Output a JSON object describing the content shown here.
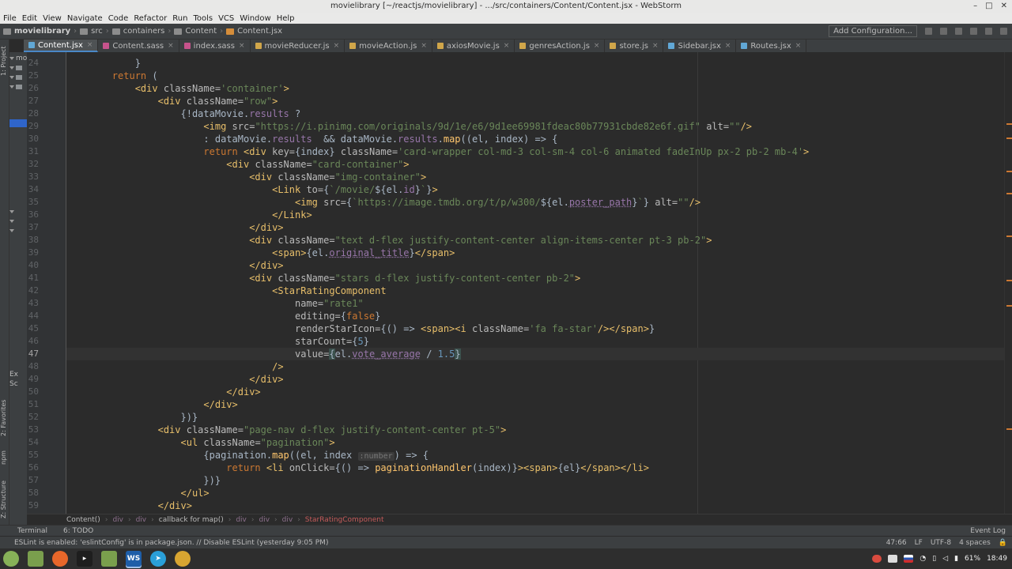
{
  "window": {
    "title": "movielibrary [~/reactjs/movielibrary] - .../src/containers/Content/Content.jsx - WebStorm",
    "controls": [
      "–",
      "□",
      "✕"
    ]
  },
  "menu": [
    "File",
    "Edit",
    "View",
    "Navigate",
    "Code",
    "Refactor",
    "Run",
    "Tools",
    "VCS",
    "Window",
    "Help"
  ],
  "breadcrumbs": [
    "movielibrary",
    "src",
    "containers",
    "Content",
    "Content.jsx"
  ],
  "toolbar": {
    "add_config": "Add Configuration..."
  },
  "tabs": [
    {
      "label": "Content.jsx",
      "kind": "jsx",
      "active": true
    },
    {
      "label": "Content.sass",
      "kind": "sass"
    },
    {
      "label": "index.sass",
      "kind": "sass"
    },
    {
      "label": "movieReducer.js",
      "kind": "js"
    },
    {
      "label": "movieAction.js",
      "kind": "js"
    },
    {
      "label": "axiosMovie.js",
      "kind": "js"
    },
    {
      "label": "genresAction.js",
      "kind": "js"
    },
    {
      "label": "store.js",
      "kind": "js"
    },
    {
      "label": "Sidebar.jsx",
      "kind": "jsx"
    },
    {
      "label": "Routes.jsx",
      "kind": "jsx"
    }
  ],
  "side_labels": {
    "project": "1: Project",
    "favorites": "2: Favorites",
    "npm": "npm",
    "structure": "Z: Structure"
  },
  "project_tree_fragments": [
    "mo",
    "Ex",
    "Sc"
  ],
  "editor": {
    "current_line": 47,
    "lines": [
      {
        "n": 24,
        "html": "            <span class=\"p\">}</span>"
      },
      {
        "n": 25,
        "html": "        <span class=\"k\">return</span> <span class=\"p\">(</span>"
      },
      {
        "n": 26,
        "html": "            <span class=\"t\">&lt;div</span> <span class=\"a\">className=</span><span class=\"s\">'container'</span><span class=\"t\">&gt;</span>"
      },
      {
        "n": 27,
        "html": "                <span class=\"t\">&lt;div</span> <span class=\"a\">className=</span><span class=\"s\">\"row\"</span><span class=\"t\">&gt;</span>"
      },
      {
        "n": 28,
        "html": "                    <span class=\"p\">{!dataMovie.</span><span class=\"v\">results</span> <span class=\"p\">?</span>"
      },
      {
        "n": 29,
        "html": "                        <span class=\"t\">&lt;img</span> <span class=\"a\">src=</span><span class=\"s\">\"https://i.pinimg.com/originals/9d/1e/e6/9d1ee69981fdeac80b77931cbde82e6f.gif\"</span> <span class=\"a\">alt=</span><span class=\"s\">\"\"</span><span class=\"t\">/&gt;</span>"
      },
      {
        "n": 30,
        "html": "                        <span class=\"p\">: dataMovie.</span><span class=\"v\">results</span>  <span class=\"p\">&amp;&amp; dataMovie.</span><span class=\"v\">results</span><span class=\"p\">.</span><span class=\"f\">map</span><span class=\"p\">((el, index) =&gt; {</span>"
      },
      {
        "n": 31,
        "html": "                        <span class=\"k\">return</span> <span class=\"t\">&lt;div</span> <span class=\"a\">key=</span><span class=\"p\">{index}</span> <span class=\"a\">className=</span><span class=\"s\">'card-wrapper col-md-3 col-sm-4 col-6 animated fadeInUp px-2 pb-2 mb-4'</span><span class=\"t\">&gt;</span>"
      },
      {
        "n": 32,
        "html": "                            <span class=\"t\">&lt;div</span> <span class=\"a\">className=</span><span class=\"s\">\"card-container\"</span><span class=\"t\">&gt;</span>"
      },
      {
        "n": 33,
        "html": "                                <span class=\"t\">&lt;div</span> <span class=\"a\">className=</span><span class=\"s\">\"img-container\"</span><span class=\"t\">&gt;</span>"
      },
      {
        "n": 34,
        "html": "                                    <span class=\"t\">&lt;Link</span> <span class=\"a\">to=</span><span class=\"p\">{</span><span class=\"s\">`/movie/</span><span class=\"p\">${el.</span><span class=\"v\">id</span><span class=\"p\">}</span><span class=\"s\">`</span><span class=\"p\">}</span><span class=\"t\">&gt;</span>"
      },
      {
        "n": 35,
        "html": "                                        <span class=\"t\">&lt;img</span> <span class=\"a\">src=</span><span class=\"p\">{</span><span class=\"s\">`https://image.tmdb.org/t/p/w300/</span><span class=\"p\">${el.</span><span class=\"v u\">poster_path</span><span class=\"p\">}</span><span class=\"s\">`</span><span class=\"p\">}</span> <span class=\"a\">alt=</span><span class=\"s\">\"\"</span><span class=\"t\">/&gt;</span>"
      },
      {
        "n": 36,
        "html": "                                    <span class=\"t\">&lt;/Link&gt;</span>"
      },
      {
        "n": 37,
        "html": "                                <span class=\"t\">&lt;/div&gt;</span>"
      },
      {
        "n": 38,
        "html": "                                <span class=\"t\">&lt;div</span> <span class=\"a\">className=</span><span class=\"s\">\"text d-flex justify-content-center align-items-center pt-3 pb-2\"</span><span class=\"t\">&gt;</span>"
      },
      {
        "n": 39,
        "html": "                                    <span class=\"t\">&lt;span&gt;</span><span class=\"p\">{el.</span><span class=\"v u\">original_title</span><span class=\"p\">}</span><span class=\"t\">&lt;/span&gt;</span>"
      },
      {
        "n": 40,
        "html": "                                <span class=\"t\">&lt;/div&gt;</span>"
      },
      {
        "n": 41,
        "html": "                                <span class=\"t\">&lt;div</span> <span class=\"a\">className=</span><span class=\"s\">\"stars d-flex justify-content-center pb-2\"</span><span class=\"t\">&gt;</span>"
      },
      {
        "n": 42,
        "html": "                                    <span class=\"t\">&lt;StarRatingComponent</span>"
      },
      {
        "n": 43,
        "html": "                                        <span class=\"a\">name=</span><span class=\"s\">\"rate1\"</span>"
      },
      {
        "n": 44,
        "html": "                                        <span class=\"a\">editing=</span><span class=\"p\">{</span><span class=\"k\">false</span><span class=\"p\">}</span>"
      },
      {
        "n": 45,
        "html": "                                        <span class=\"a\">renderStarIcon=</span><span class=\"p\">{() =&gt; </span><span class=\"t\">&lt;span&gt;&lt;i</span> <span class=\"a\">className=</span><span class=\"s\">'fa fa-star'</span><span class=\"t\">/&gt;&lt;/span&gt;</span><span class=\"p\">}</span>"
      },
      {
        "n": 46,
        "html": "                                        <span class=\"a\">starCount=</span><span class=\"p\">{</span><span class=\"n\">5</span><span class=\"p\">}</span>"
      },
      {
        "n": 47,
        "html": "                                        <span class=\"a\">value=</span><span class=\"p\" style=\"background:#3b514d\">{</span><span class=\"p\">el.</span><span class=\"v u\">vote_average</span> <span class=\"p\">/ </span><span class=\"n\">1.5</span><span class=\"p\" style=\"background:#3b514d\">}</span>"
      },
      {
        "n": 48,
        "html": "                                    <span class=\"t\">/&gt;</span>"
      },
      {
        "n": 49,
        "html": "                                <span class=\"t\">&lt;/div&gt;</span>"
      },
      {
        "n": 50,
        "html": "                            <span class=\"t\">&lt;/div&gt;</span>"
      },
      {
        "n": 51,
        "html": "                        <span class=\"t\">&lt;/div&gt;</span>"
      },
      {
        "n": 52,
        "html": "                    <span class=\"p\">})}</span>"
      },
      {
        "n": 53,
        "html": "                <span class=\"t\">&lt;div</span> <span class=\"a\">className=</span><span class=\"s\">\"page-nav d-flex justify-content-center pt-5\"</span><span class=\"t\">&gt;</span>"
      },
      {
        "n": 54,
        "html": "                    <span class=\"t\">&lt;ul</span> <span class=\"a\">className=</span><span class=\"s\">\"pagination\"</span><span class=\"t\">&gt;</span>"
      },
      {
        "n": 55,
        "html": "                        <span class=\"p\">{pagination.</span><span class=\"f\">map</span><span class=\"p\">((el, index</span> <span class=\"hint\">:number</span><span class=\"p\">) =&gt; {</span>"
      },
      {
        "n": 56,
        "html": "                            <span class=\"k\">return</span> <span class=\"t\">&lt;li</span> <span class=\"a\">onClick=</span><span class=\"p\">{() =&gt; </span><span class=\"f\">paginationHandler</span><span class=\"p\">(index)}</span><span class=\"t\">&gt;&lt;span&gt;</span><span class=\"p\">{el}</span><span class=\"t\">&lt;/span&gt;&lt;/li&gt;</span>"
      },
      {
        "n": 57,
        "html": "                        <span class=\"p\">})}</span>"
      },
      {
        "n": 58,
        "html": "                    <span class=\"t\">&lt;/ul&gt;</span>"
      },
      {
        "n": 59,
        "html": "                <span class=\"t\">&lt;/div&gt;</span>"
      }
    ]
  },
  "code_breadcrumb": [
    "Content()",
    "div",
    "div",
    "callback for map()",
    "div",
    "div",
    "div",
    "StarRatingComponent"
  ],
  "tool_windows": {
    "terminal": "Terminal",
    "todo": "6: TODO",
    "event_log": "Event Log"
  },
  "status": {
    "message": "ESLint is enabled: 'eslintConfig' is in package.json. // Disable ESLint (yesterday 9:05 PM)",
    "position": "47:66",
    "line_sep": "LF",
    "encoding": "UTF-8",
    "indent": "4 spaces"
  },
  "tray": {
    "battery": "61%",
    "clock": "18:49"
  }
}
